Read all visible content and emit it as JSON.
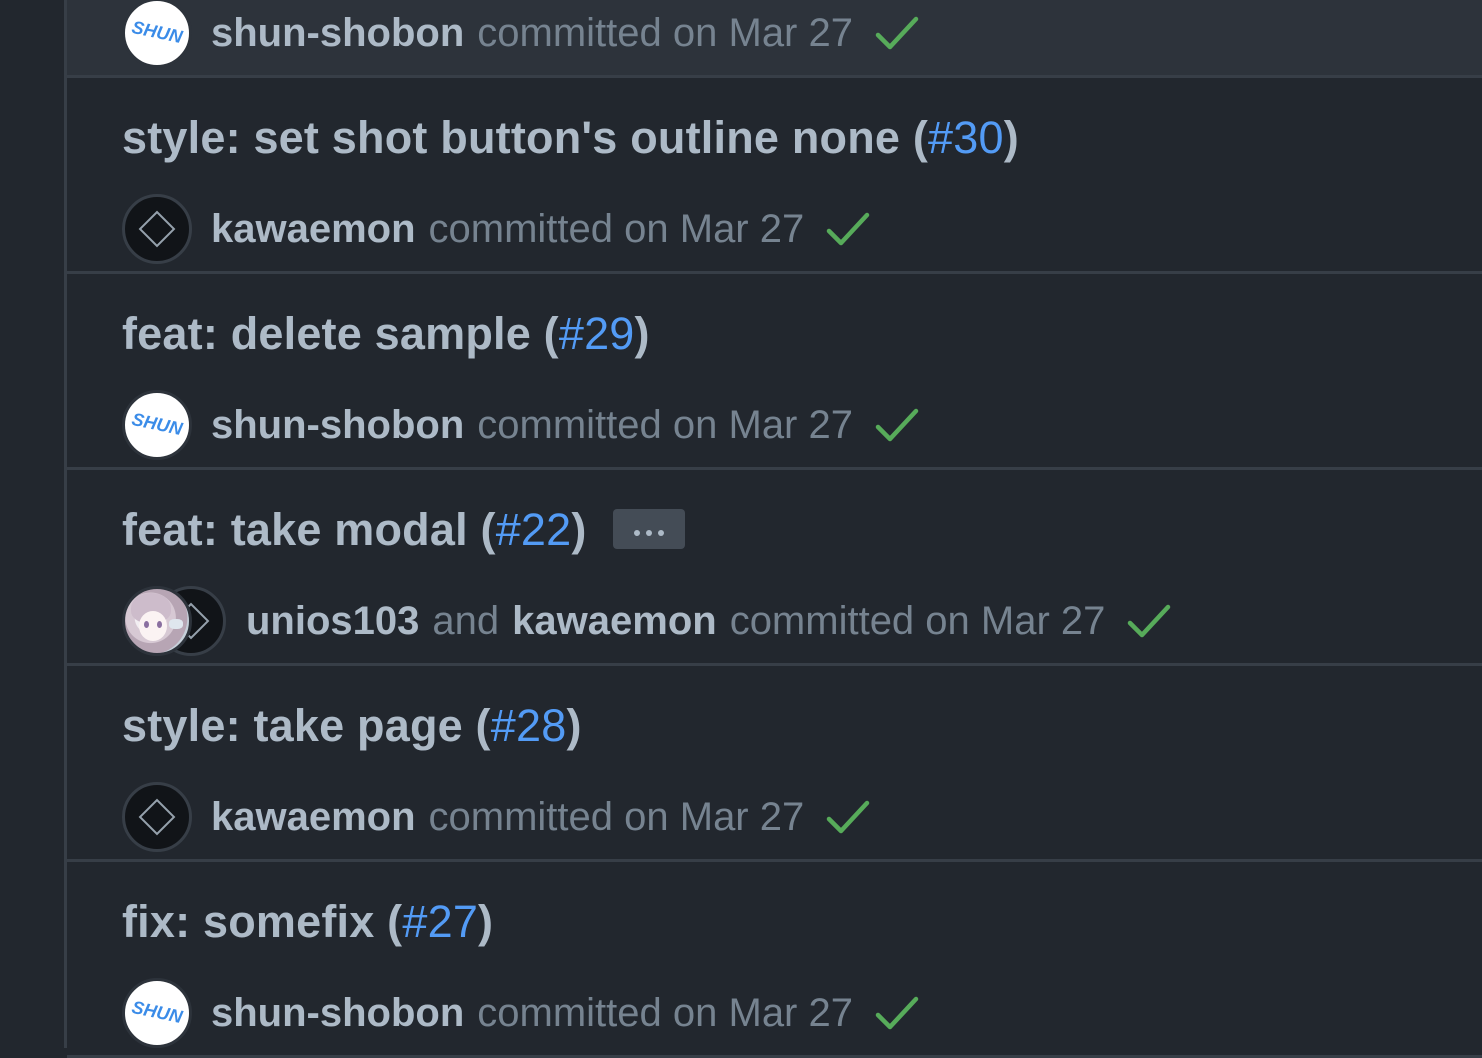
{
  "commits": [
    {
      "title_prefix": "",
      "pr_number": "",
      "authors": [
        "shun-shobon"
      ],
      "committed_text": "committed on Mar 27",
      "status": "success"
    },
    {
      "title_prefix": "style: set shot button's outline none (",
      "pr_number": "#30",
      "title_suffix": ")",
      "authors": [
        "kawaemon"
      ],
      "committed_text": "committed on Mar 27",
      "status": "success"
    },
    {
      "title_prefix": "feat: delete sample (",
      "pr_number": "#29",
      "title_suffix": ")",
      "authors": [
        "shun-shobon"
      ],
      "committed_text": "committed on Mar 27",
      "status": "success"
    },
    {
      "title_prefix": "feat: take modal (",
      "pr_number": "#22",
      "title_suffix": ")",
      "authors": [
        "unios103",
        "kawaemon"
      ],
      "and_text": "and",
      "committed_text": "committed on Mar 27",
      "status": "success",
      "has_expand_button": true
    },
    {
      "title_prefix": "style: take page (",
      "pr_number": "#28",
      "title_suffix": ")",
      "authors": [
        "kawaemon"
      ],
      "committed_text": "committed on Mar 27",
      "status": "success"
    },
    {
      "title_prefix": "fix: somefix (",
      "pr_number": "#27",
      "title_suffix": ")",
      "authors": [
        "shun-shobon"
      ],
      "committed_text": "committed on Mar 27",
      "status": "success"
    }
  ],
  "avatar_logo_text": "SHUN",
  "icons": {
    "status": "check-icon",
    "expand": "ellipsis-icon"
  },
  "colors": {
    "background": "#22272e",
    "row_highlight": "#2d333b",
    "border": "#373e47",
    "text_primary": "#adbac7",
    "text_muted": "#768390",
    "link": "#539bf5",
    "success": "#57ab5a"
  }
}
